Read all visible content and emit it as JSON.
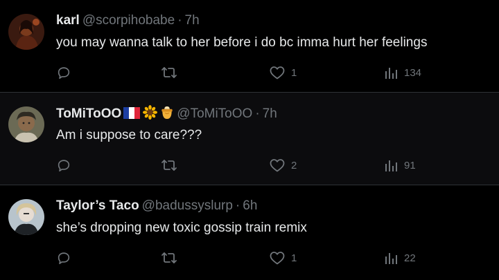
{
  "tweets": [
    {
      "name": "karl",
      "handle": "@scorpihobabe",
      "separator": "·",
      "time": "7h",
      "text": "you may wanna talk to her before i do bc imma hurt her feelings",
      "likes": "1",
      "views": "134",
      "replies": "",
      "retweets": ""
    },
    {
      "name": "ToMiToOO",
      "handle": "@ToMiToOO",
      "separator": "·",
      "time": "7h",
      "text": "Am i suppose to care???",
      "likes": "2",
      "views": "91",
      "replies": "",
      "retweets": "",
      "name_icons": [
        "france-flag-icon",
        "sunflower-icon",
        "honey-pot-icon"
      ]
    },
    {
      "name": "Taylor’s Taco",
      "handle": "@badussyslurp",
      "separator": "·",
      "time": "6h",
      "text": "she’s dropping new toxic gossip train remix",
      "likes": "1",
      "views": "22",
      "replies": "",
      "retweets": ""
    }
  ],
  "colors": {
    "background": "#000000",
    "text": "#e7e9ea",
    "muted": "#71767b",
    "divider": "#2f3336"
  }
}
